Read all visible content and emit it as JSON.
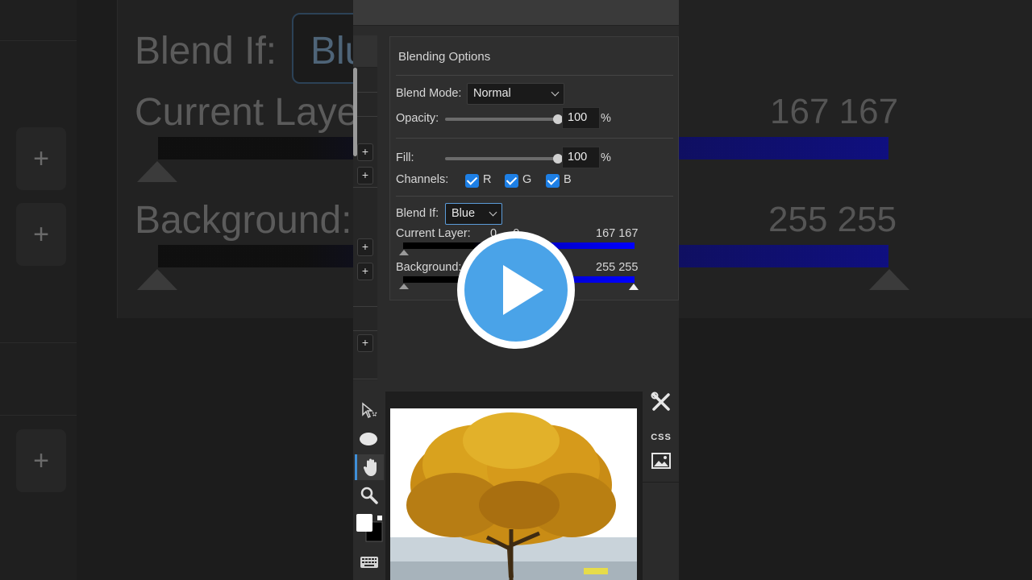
{
  "background_zoom": {
    "blend_if_label": "Blend If:",
    "blend_if_value": "Blu",
    "current_layer_label": "Current Laye",
    "current_layer_values": "167 167",
    "background_label": "Background:",
    "background_values": "255 255",
    "plus": "+"
  },
  "blending_options": {
    "title": "Blending Options",
    "blend_mode": {
      "label": "Blend Mode:",
      "value": "Normal"
    },
    "opacity": {
      "label": "Opacity:",
      "value": "100",
      "unit": "%",
      "level": 1.0
    },
    "fill": {
      "label": "Fill:",
      "value": "100",
      "unit": "%",
      "level": 1.0
    },
    "channels": {
      "label": "Channels:",
      "items": [
        {
          "label": "R",
          "checked": true
        },
        {
          "label": "G",
          "checked": true
        },
        {
          "label": "B",
          "checked": true
        }
      ]
    },
    "blend_if": {
      "label": "Blend If:",
      "value": "Blue"
    },
    "current_layer": {
      "label": "Current Layer:",
      "min_values": "0     0",
      "max_values": "167 167"
    },
    "background_layer": {
      "label": "Background:",
      "max_values": "255 255"
    }
  },
  "layer_panel": {
    "plus": "+"
  },
  "tools": [
    {
      "name": "select-tool",
      "icon": "arrow-select-icon"
    },
    {
      "name": "ellipse-tool",
      "icon": "ellipse-icon"
    },
    {
      "name": "hand-tool",
      "icon": "hand-icon",
      "active": true
    },
    {
      "name": "zoom-tool",
      "icon": "magnifier-icon"
    },
    {
      "name": "color-swatch",
      "icon": "fg-bg-color-icon"
    },
    {
      "name": "keyboard",
      "icon": "keyboard-icon"
    }
  ],
  "right_panel": {
    "css_label": "CSS"
  },
  "colors": {
    "accent": "#1d7fe5",
    "play": "#4aa3e8",
    "bar_blue": "#0000ff"
  },
  "video_overlay": {
    "icon": "play-icon"
  }
}
